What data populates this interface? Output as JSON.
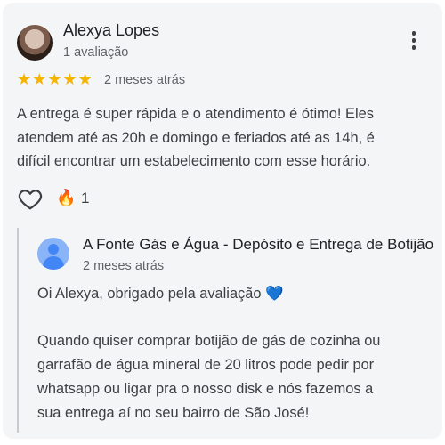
{
  "review": {
    "author": "Alexya Lopes",
    "author_sub": "1 avaliação",
    "rating_stars": 5,
    "stars_text": "★★★★★",
    "date": "2 meses atrás",
    "text": "A entrega é super rápida e o atendimento é ótimo! Eles\natendem até as 20h e domingo e feriados até as 14h, é\ndifícil encontrar um estabelecimento com esse horário.",
    "reaction_icon": "🔥",
    "reaction_count": "1"
  },
  "owner_reply": {
    "name": "A Fonte Gás e Água - Depósito e Entrega de Botijão",
    "date": "2 meses atrás",
    "text_line1": "Oi Alexya, obrigado pela avaliação",
    "heart_emoji": "💙",
    "text_rest": "Quando quiser comprar botijão de gás de cozinha ou\ngarrafão de água mineral de 20 litros pode pedir por\nwhatsapp ou ligar pra o nosso disk e nós fazemos a\nsua entrega aí no seu bairro de São José!"
  },
  "colors": {
    "star": "#f4b400",
    "card_bg": "#f4f5f7",
    "owner_avatar": "#4285f4",
    "blue_heart": "#1a73e8"
  },
  "icons": [
    "avatar-photo",
    "more-vert-icon",
    "star-icon",
    "heart-outline-icon",
    "fire-icon",
    "person-icon",
    "blue-heart-icon"
  ]
}
